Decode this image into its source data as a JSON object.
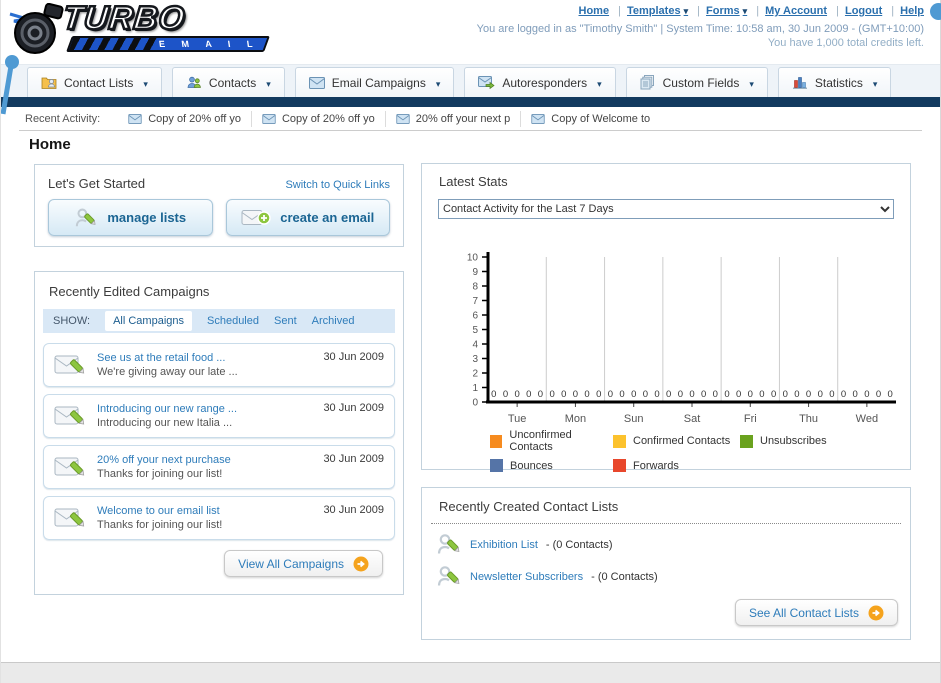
{
  "header": {
    "logo_line1": "TURBO",
    "logo_line2": "E M A I L",
    "nav_links": [
      {
        "label": "Home",
        "dropdown": false
      },
      {
        "label": "Templates",
        "dropdown": true
      },
      {
        "label": "Forms",
        "dropdown": true
      },
      {
        "label": "My Account",
        "dropdown": false
      },
      {
        "label": "Logout",
        "dropdown": false
      },
      {
        "label": "Help",
        "dropdown": false
      }
    ],
    "login_line": "You are logged in as \"Timothy Smith\" | System Time: 10:58 am, 30 Jun 2009 - (GMT+10:00)",
    "credits_line": "You have 1,000 total credits left."
  },
  "tabs": [
    {
      "label": "Contact Lists"
    },
    {
      "label": "Contacts"
    },
    {
      "label": "Email Campaigns"
    },
    {
      "label": "Autoresponders"
    },
    {
      "label": "Custom Fields"
    },
    {
      "label": "Statistics"
    }
  ],
  "recent_activity": {
    "label": "Recent Activity:",
    "items": [
      {
        "text": "Copy of 20% off yo"
      },
      {
        "text": "Copy of 20% off yo"
      },
      {
        "text": "20% off your next p"
      },
      {
        "text": "Copy of Welcome to"
      }
    ]
  },
  "page_title": "Home",
  "get_started": {
    "title": "Let's Get Started",
    "switch_link": "Switch to Quick Links",
    "manage_lists_label": "manage lists",
    "create_email_label": "create an email"
  },
  "campaigns": {
    "title": "Recently Edited Campaigns",
    "show_label": "SHOW:",
    "filters": [
      "All Campaigns",
      "Scheduled",
      "Sent",
      "Archived"
    ],
    "active_filter": "All Campaigns",
    "items": [
      {
        "title": "See us at the retail food ...",
        "subtitle": "We're giving away our late ...",
        "date": "30 Jun 2009"
      },
      {
        "title": "Introducing our new range ...",
        "subtitle": "Introducing our new Italia ...",
        "date": "30 Jun 2009"
      },
      {
        "title": "20% off your next purchase",
        "subtitle": "Thanks for joining our list!",
        "date": "30 Jun 2009"
      },
      {
        "title": "Welcome to our email list",
        "subtitle": "Thanks for joining our list!",
        "date": "30 Jun 2009"
      }
    ],
    "view_all_label": "View All Campaigns"
  },
  "stats": {
    "title": "Latest Stats",
    "dropdown_value": "Contact Activity for the Last 7 Days"
  },
  "chart_data": {
    "type": "bar",
    "title": "Contact Activity for the Last 7 Days",
    "categories": [
      "Tue",
      "Mon",
      "Sun",
      "Sat",
      "Fri",
      "Thu",
      "Wed"
    ],
    "series": [
      {
        "name": "Unconfirmed Contacts",
        "color": "#f68b1f",
        "values": [
          0,
          0,
          0,
          0,
          0,
          0,
          0
        ]
      },
      {
        "name": "Confirmed Contacts",
        "color": "#fcc22d",
        "values": [
          0,
          0,
          0,
          0,
          0,
          0,
          0
        ]
      },
      {
        "name": "Unsubscribes",
        "color": "#6aa21e",
        "values": [
          0,
          0,
          0,
          0,
          0,
          0,
          0
        ]
      },
      {
        "name": "Bounces",
        "color": "#5574a7",
        "values": [
          0,
          0,
          0,
          0,
          0,
          0,
          0
        ]
      },
      {
        "name": "Forwards",
        "color": "#e8472c",
        "values": [
          0,
          0,
          0,
          0,
          0,
          0,
          0
        ]
      }
    ],
    "ylim": [
      0,
      10
    ],
    "yticks": [
      0,
      1,
      2,
      3,
      4,
      5,
      6,
      7,
      8,
      9,
      10
    ],
    "legend_position": "bottom",
    "grid": "vertical-group-separators"
  },
  "contact_lists": {
    "title": "Recently Created Contact Lists",
    "items": [
      {
        "name": "Exhibition List",
        "count": "- (0 Contacts)"
      },
      {
        "name": "Newsletter Subscribers",
        "count": "- (0 Contacts)"
      }
    ],
    "see_all_label": "See All Contact Lists"
  },
  "colors": {
    "navy_bar": "#123a5f",
    "link_blue": "#2e7cba",
    "arrow_button_orange": "#f5a31d",
    "callout_blue": "#4f9ad3"
  }
}
